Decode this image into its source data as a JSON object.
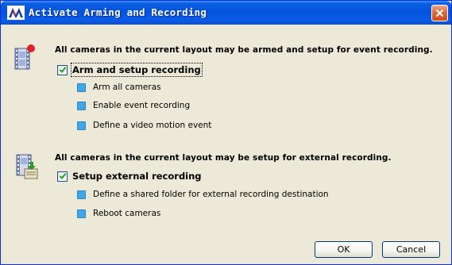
{
  "window": {
    "title": "Activate Arming and Recording"
  },
  "section1": {
    "description": "All cameras in the current layout may be armed and setup for event recording.",
    "checkbox_label": "Arm and setup recording",
    "checked": true,
    "items": [
      {
        "label": "Arm all cameras"
      },
      {
        "label": "Enable event recording"
      },
      {
        "label": "Define a video motion event"
      }
    ]
  },
  "section2": {
    "description": "All cameras in the current layout may be setup for external recording.",
    "checkbox_label": "Setup external recording",
    "checked": true,
    "items": [
      {
        "label": "Define a shared folder for external recording destination"
      },
      {
        "label": "Reboot cameras"
      }
    ]
  },
  "buttons": {
    "ok_label": "OK",
    "cancel_label": "Cancel"
  },
  "colors": {
    "titlebar": "#0553dd",
    "bullet": "#3fa6e8",
    "check": "#21a121",
    "close": "#e06a3a"
  }
}
